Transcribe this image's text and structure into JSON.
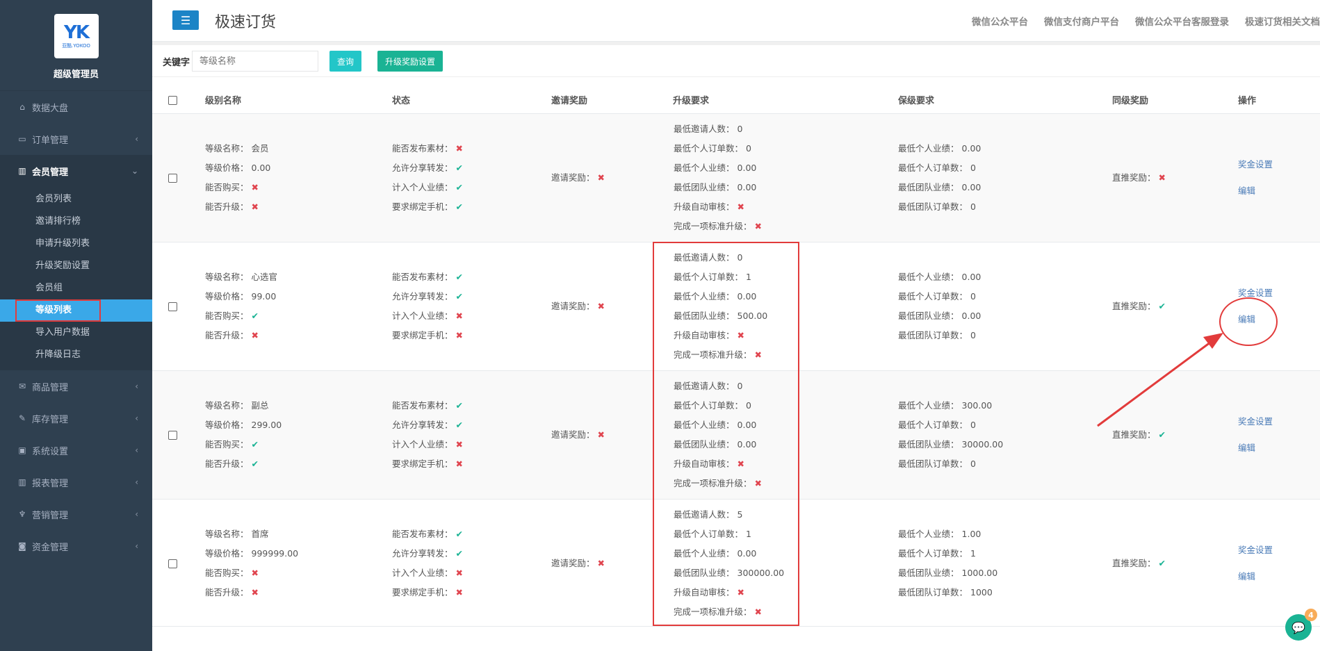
{
  "sidebar": {
    "logo_mark": "YK",
    "logo_sub": "亚酷.YOKOO",
    "admin_name": "超级管理员",
    "menu": [
      {
        "icon": "home-icon",
        "glyph": "⌂",
        "label": "数据大盘"
      },
      {
        "icon": "list-icon",
        "glyph": "▭",
        "label": "订单管理"
      },
      {
        "icon": "chart-icon",
        "glyph": "▥",
        "label": "会员管理"
      },
      {
        "icon": "envelope-icon",
        "glyph": "✉",
        "label": "商品管理"
      },
      {
        "icon": "edit-icon",
        "glyph": "✎",
        "label": "库存管理"
      },
      {
        "icon": "desktop-icon",
        "glyph": "▣",
        "label": "系统设置"
      },
      {
        "icon": "bar-chart-icon",
        "glyph": "▥",
        "label": "报表管理"
      },
      {
        "icon": "cutlery-icon",
        "glyph": "♆",
        "label": "营销管理"
      },
      {
        "icon": "money-icon",
        "glyph": "◙",
        "label": "资金管理"
      }
    ],
    "submenu": [
      "会员列表",
      "邀请排行榜",
      "申请升级列表",
      "升级奖励设置",
      "会员组",
      "等级列表",
      "导入用户数据",
      "升降级日志"
    ]
  },
  "topbar": {
    "title": "极速订货",
    "links": [
      "微信公众平台",
      "微信支付商户平台",
      "微信公众平台客服登录",
      "极速订货相关文档"
    ]
  },
  "search": {
    "label": "关键字",
    "placeholder": "等级名称",
    "query_btn": "查询",
    "upgrade_btn": "升级奖励设置"
  },
  "table": {
    "headers": [
      "级别名称",
      "状态",
      "邀请奖励",
      "升级要求",
      "保级要求",
      "同级奖励",
      "操作"
    ],
    "rows": [
      {
        "name": "会员",
        "price": "0.00",
        "can_buy": "x",
        "can_upgrade": "x",
        "publish": "x",
        "share": "ok",
        "personal": "ok",
        "bind_phone": "ok",
        "invite_reward": "x",
        "up_invite": "0",
        "up_orders": "0",
        "up_personal": "0.00",
        "up_team": "0.00",
        "up_auto": "x",
        "up_any": "x",
        "keep_personal": "0.00",
        "keep_orders": "0",
        "keep_team": "0.00",
        "keep_team_orders": "0",
        "direct_reward": "x"
      },
      {
        "name": "心选官",
        "price": "99.00",
        "can_buy": "ok",
        "can_upgrade": "x",
        "publish": "ok",
        "share": "ok",
        "personal": "x",
        "bind_phone": "x",
        "invite_reward": "x",
        "up_invite": "0",
        "up_orders": "1",
        "up_personal": "0.00",
        "up_team": "500.00",
        "up_auto": "x",
        "up_any": "x",
        "keep_personal": "0.00",
        "keep_orders": "0",
        "keep_team": "0.00",
        "keep_team_orders": "0",
        "direct_reward": "ok"
      },
      {
        "name": "副总",
        "price": "299.00",
        "can_buy": "ok",
        "can_upgrade": "ok",
        "publish": "ok",
        "share": "ok",
        "personal": "x",
        "bind_phone": "x",
        "invite_reward": "x",
        "up_invite": "0",
        "up_orders": "0",
        "up_personal": "0.00",
        "up_team": "0.00",
        "up_auto": "x",
        "up_any": "x",
        "keep_personal": "300.00",
        "keep_orders": "0",
        "keep_team": "30000.00",
        "keep_team_orders": "0",
        "direct_reward": "ok"
      },
      {
        "name": "首席",
        "price": "999999.00",
        "can_buy": "x",
        "can_upgrade": "x",
        "publish": "ok",
        "share": "ok",
        "personal": "x",
        "bind_phone": "x",
        "invite_reward": "x",
        "up_invite": "5",
        "up_orders": "1",
        "up_personal": "0.00",
        "up_team": "300000.00",
        "up_auto": "x",
        "up_any": "x",
        "keep_personal": "1.00",
        "keep_orders": "1",
        "keep_team": "1000.00",
        "keep_team_orders": "1000",
        "direct_reward": "ok"
      }
    ],
    "labels": {
      "name": "等级名称：",
      "price": "等级价格：",
      "can_buy": "能否购买：",
      "can_upgrade": "能否升级：",
      "publish": "能否发布素材：",
      "share": "允许分享转发：",
      "personal": "计入个人业绩：",
      "bind_phone": "要求绑定手机：",
      "invite_reward": "邀请奖励：",
      "up_invite": "最低邀请人数：",
      "up_orders": "最低个人订单数：",
      "up_personal": "最低个人业绩：",
      "up_team": "最低团队业绩：",
      "up_auto": "升级自动审核：",
      "up_any": "完成一项标准升级：",
      "keep_personal": "最低个人业绩：",
      "keep_orders": "最低个人订单数：",
      "keep_team": "最低团队业绩：",
      "keep_team_orders": "最低团队订单数：",
      "direct_reward": "直推奖励：",
      "bonus_link": "奖金设置",
      "edit_link": "编辑"
    }
  },
  "chat_badge": "4",
  "colors": {
    "sidebar": "#2f4050",
    "active": "#3aa8e8",
    "primary": "#1c84c6",
    "info": "#23c6c8",
    "success": "#1ab394",
    "danger": "#e0454f",
    "annotation": "#e23b3b"
  }
}
